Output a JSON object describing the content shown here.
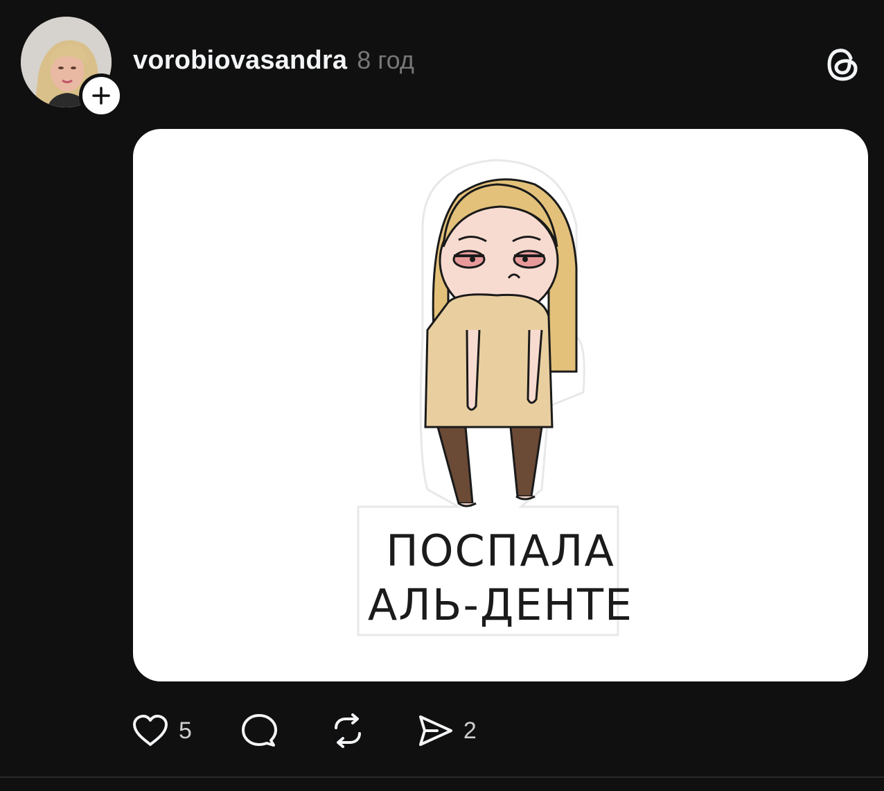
{
  "post": {
    "username": "vorobiovasandra",
    "time": "8 год",
    "avatar_icon": "profile-photo",
    "follow_icon": "plus-icon",
    "logo_icon": "threads-logo-icon"
  },
  "media": {
    "caption_line_1": "ПОСПАЛА",
    "caption_line_2": "АЛЬ-ДЕНТЕ"
  },
  "actions": {
    "likes": "5",
    "shares": "2"
  },
  "colors": {
    "background": "#101010",
    "text": "#f3f5f7",
    "muted": "#777777",
    "media_bg": "#ffffff"
  }
}
